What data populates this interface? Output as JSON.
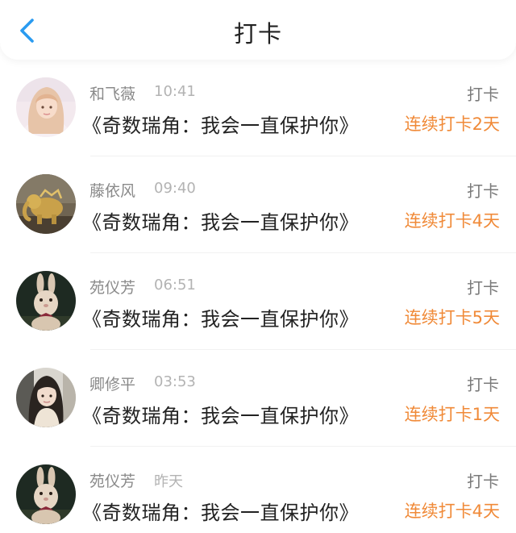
{
  "header": {
    "title": "打卡",
    "back_icon": "chevron-left-icon",
    "accent_color": "#2a9bf0"
  },
  "items": [
    {
      "name": "和飞薇",
      "time": "10:41",
      "subject": "《奇数瑞角：我会一直保护你》",
      "action": "打卡",
      "streak": "连续打卡2天",
      "avatar_icon": "girl-avatar"
    },
    {
      "name": "藤依风",
      "time": "09:40",
      "subject": "《奇数瑞角：我会一直保护你》",
      "action": "打卡",
      "streak": "连续打卡4天",
      "avatar_icon": "elephant-avatar"
    },
    {
      "name": "苑仪芳",
      "time": "06:51",
      "subject": "《奇数瑞角：我会一直保护你》",
      "action": "打卡",
      "streak": "连续打卡5天",
      "avatar_icon": "rabbit-avatar"
    },
    {
      "name": "卿修平",
      "time": "03:53",
      "subject": "《奇数瑞角：我会一直保护你》",
      "action": "打卡",
      "streak": "连续打卡1天",
      "avatar_icon": "girl-avatar"
    },
    {
      "name": "苑仪芳",
      "time": "昨天",
      "subject": "《奇数瑞角：我会一直保护你》",
      "action": "打卡",
      "streak": "连续打卡4天",
      "avatar_icon": "rabbit-avatar"
    }
  ],
  "colors": {
    "streak": "#f08a38",
    "name": "#8a8a8a",
    "time": "#b3b3b3",
    "subject": "#222222"
  }
}
